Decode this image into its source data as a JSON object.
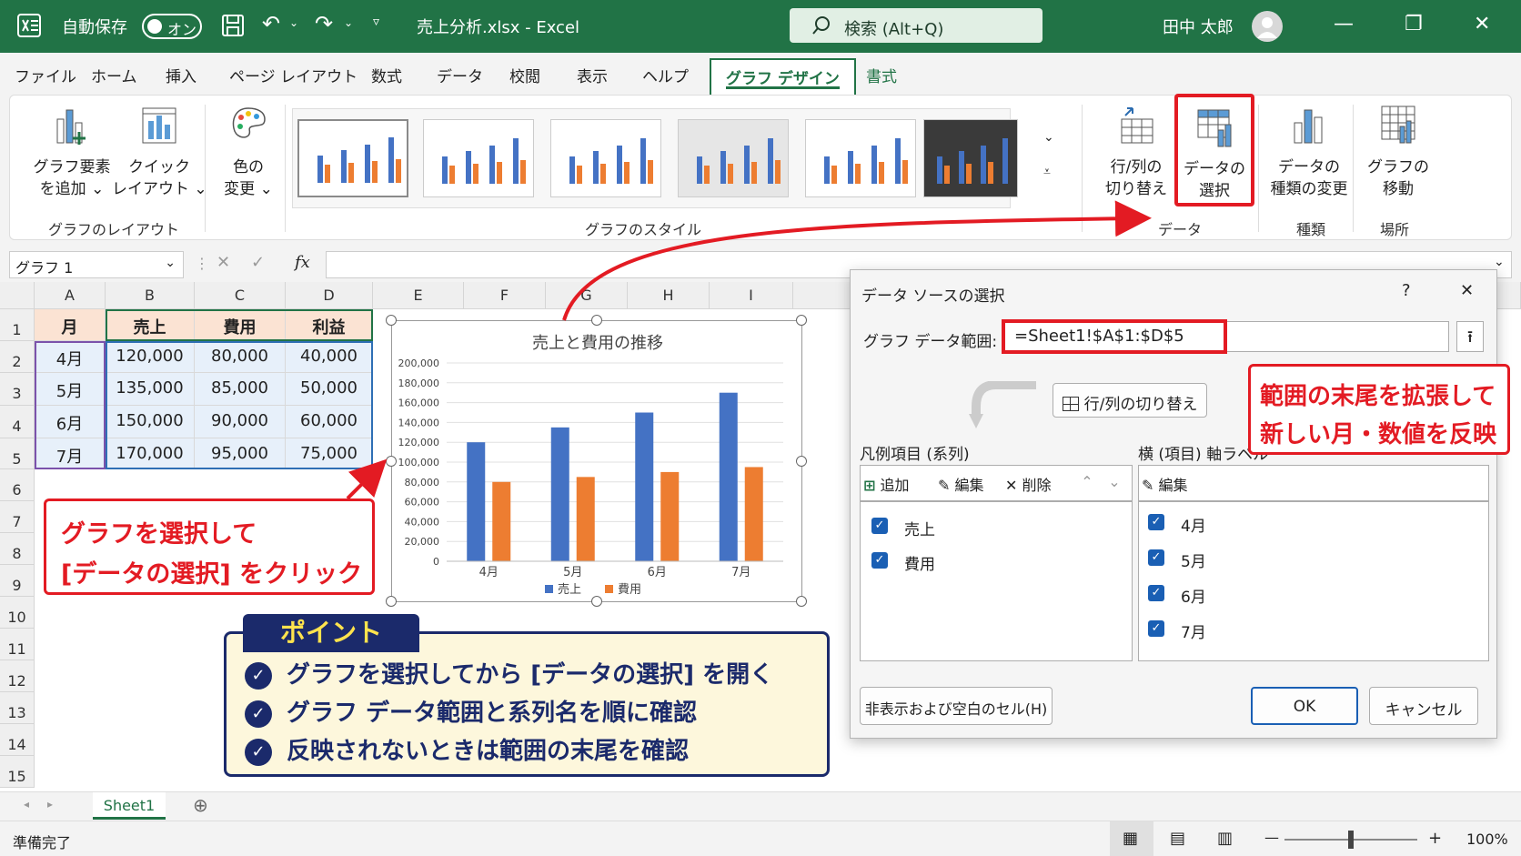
{
  "titlebar": {
    "autosave_label": "自動保存",
    "autosave_state": "オン",
    "filename": "売上分析.xlsx  -  Excel",
    "search_placeholder": "検索 (Alt+Q)",
    "user": "田中 太郎"
  },
  "tabs": [
    "ファイル",
    "ホーム",
    "挿入",
    "ページ レイアウト",
    "数式",
    "データ",
    "校閲",
    "表示",
    "ヘルプ",
    "グラフ デザイン",
    "書式"
  ],
  "ribbon": {
    "add_element": [
      "グラフ要素",
      "を追加 ⌄"
    ],
    "quick_layout": [
      "クイック",
      "レイアウト ⌄"
    ],
    "change_color": [
      "色の",
      "変更 ⌄"
    ],
    "group_layout": "グラフのレイアウト",
    "group_style": "グラフのスタイル",
    "switch_rowcol": [
      "行/列の",
      "切り替え"
    ],
    "select_data": [
      "データの",
      "選択"
    ],
    "change_type": [
      "データの",
      "種類の変更"
    ],
    "move_chart": [
      "グラフの",
      "移動"
    ],
    "group_data": "データ",
    "group_type": "種類",
    "group_location": "場所"
  },
  "formula_bar": {
    "name_box": "グラフ 1",
    "fx": "fx"
  },
  "sheet": {
    "columns": [
      "A",
      "B",
      "C",
      "D",
      "E",
      "F",
      "G",
      "H",
      "I"
    ],
    "rows": [
      "1",
      "2",
      "3",
      "4",
      "5",
      "6",
      "7",
      "8",
      "9",
      "10",
      "11",
      "12",
      "13",
      "14",
      "15"
    ],
    "headers": [
      "月",
      "売上",
      "費用",
      "利益"
    ],
    "data": [
      [
        "4月",
        "120,000",
        "80,000",
        "40,000"
      ],
      [
        "5月",
        "135,000",
        "85,000",
        "50,000"
      ],
      [
        "6月",
        "150,000",
        "90,000",
        "60,000"
      ],
      [
        "7月",
        "170,000",
        "95,000",
        "75,000"
      ]
    ],
    "tab": "Sheet1"
  },
  "chart_data": {
    "type": "bar",
    "title": "売上と費用の推移",
    "categories": [
      "4月",
      "5月",
      "6月",
      "7月"
    ],
    "series": [
      {
        "name": "売上",
        "values": [
          120000,
          135000,
          150000,
          170000
        ],
        "color": "#4472c4"
      },
      {
        "name": "費用",
        "values": [
          80000,
          85000,
          90000,
          95000
        ],
        "color": "#ed7d31"
      }
    ],
    "y_ticks": [
      "200,000",
      "180,000",
      "160,000",
      "140,000",
      "120,000",
      "100,000",
      "80,000",
      "60,000",
      "40,000",
      "20,000",
      "0"
    ],
    "ylim": [
      0,
      200000
    ],
    "grid": true,
    "legend": "bottom"
  },
  "dialog": {
    "title": "データ ソースの選択",
    "help": "?",
    "close": "✕",
    "range_label": "グラフ データ範囲:",
    "range_value": "=Sheet1!$A$1:$D$5",
    "switch_button": "行/列の切り替え",
    "legend_label": "凡例項目 (系列)",
    "axis_label": "横 (項目) 軸ラベル",
    "add": "追加",
    "edit": "編集",
    "delete": "削除",
    "axis_edit": "編集",
    "series": [
      "売上",
      "費用"
    ],
    "axis_items": [
      "4月",
      "5月",
      "6月",
      "7月"
    ],
    "hidden_cells": "非表示および空白のセル(H)",
    "ok": "OK",
    "cancel": "キャンセル"
  },
  "callouts": {
    "left": [
      "グラフを選択して",
      "[データの選択] をクリック"
    ],
    "right": [
      "範囲の末尾を拡張して",
      "新しい月・数値を反映"
    ]
  },
  "point": {
    "tag": "ポイント",
    "items": [
      "グラフを選択してから [データの選択] を開く",
      "グラフ データ範囲と系列名を順に確認",
      "反映されないときは範囲の末尾を確認"
    ]
  },
  "status": {
    "ready": "準備完了",
    "zoom": "100%"
  },
  "colors": {
    "excel_green": "#217346",
    "callout_red": "#e31b23",
    "point_navy": "#1b2a6b"
  }
}
